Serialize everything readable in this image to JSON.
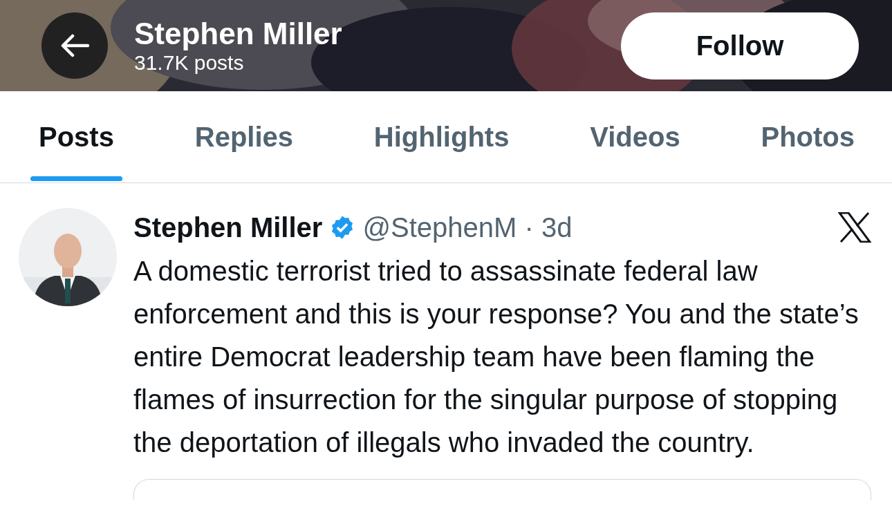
{
  "header": {
    "name": "Stephen Miller",
    "post_count": "31.7K posts",
    "follow_label": "Follow"
  },
  "tabs": [
    {
      "label": "Posts",
      "selected": true
    },
    {
      "label": "Replies",
      "selected": false
    },
    {
      "label": "Highlights",
      "selected": false
    },
    {
      "label": "Videos",
      "selected": false
    },
    {
      "label": "Photos",
      "selected": false
    }
  ],
  "post": {
    "author": "Stephen Miller",
    "verified": true,
    "meta": "@StephenM · 3d",
    "text": "A domestic terrorist tried to assassinate federal law enforcement and this is your response? You and the state’s entire Democrat leadership team have been flaming the flames of insurrection for the singular purpose of stopping the deportation of illegals who invaded the country."
  }
}
